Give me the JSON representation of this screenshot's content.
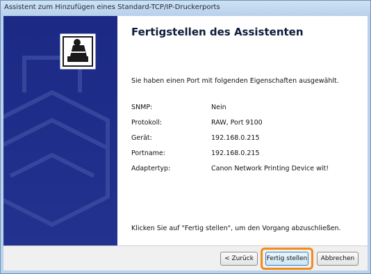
{
  "window": {
    "title": "Assistent zum Hinzufügen eines Standard-TCP/IP-Druckerports"
  },
  "sidebar": {
    "icon": "printer-wizard-icon"
  },
  "main": {
    "heading": "Fertigstellen des Assistenten",
    "intro": "Sie haben einen Port mit folgenden Eigenschaften ausgewählt.",
    "properties": [
      {
        "label": "SNMP:",
        "value": "Nein"
      },
      {
        "label": "Protokoll:",
        "value": "RAW, Port 9100"
      },
      {
        "label": "Gerät:",
        "value": "192.168.0.215"
      },
      {
        "label": "Portname:",
        "value": "192.168.0.215"
      },
      {
        "label": "Adaptertyp:",
        "value": "Canon Network Printing Device wit!"
      }
    ],
    "finish_note": "Klicken Sie auf \"Fertig stellen\", um den Vorgang abzuschließen."
  },
  "footer": {
    "back_label": "< Zurück",
    "finish_label": "Fertig stellen",
    "cancel_label": "Abbrechen"
  },
  "colors": {
    "sidebar": "#1e2c88",
    "highlight": "#f28a1c"
  }
}
